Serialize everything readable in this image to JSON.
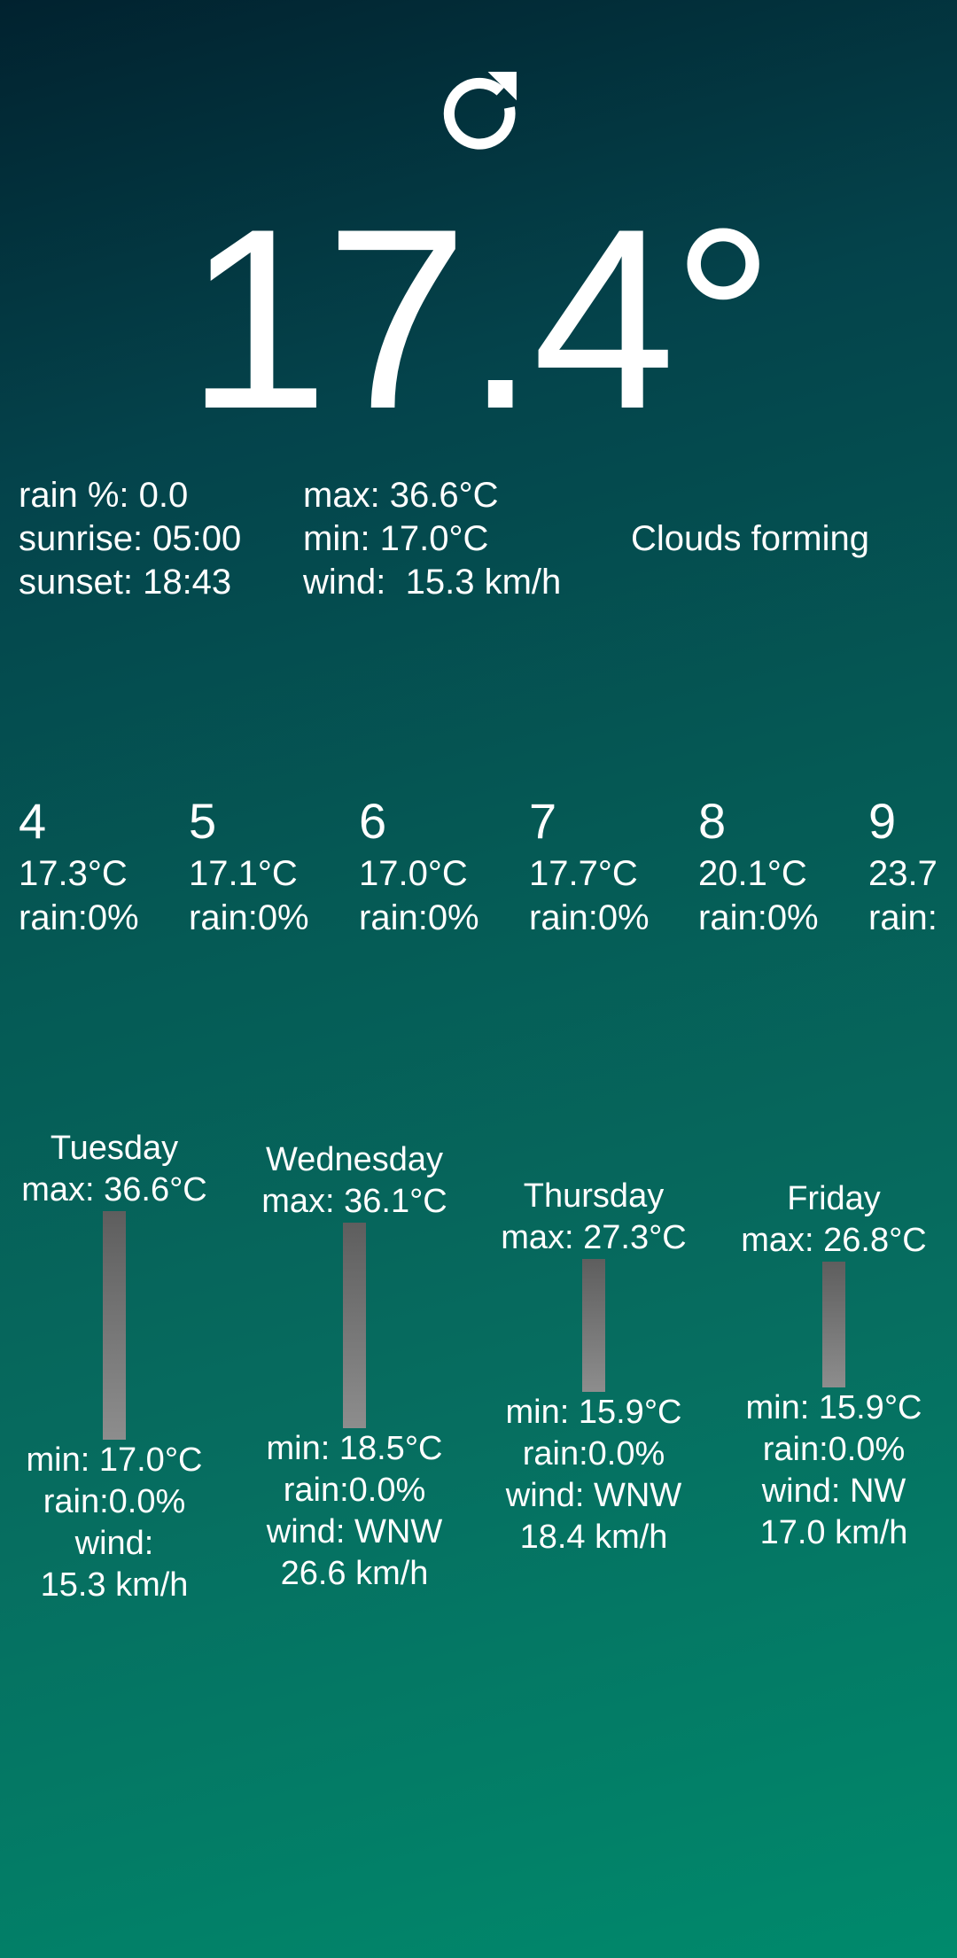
{
  "current": {
    "temperature": "17.4°",
    "rain": "rain %: 0.0",
    "sunrise": "sunrise: 05:00",
    "sunset": "sunset: 18:43",
    "max": "max: 36.6°C",
    "min": "min: 17.0°C",
    "wind": "wind:  15.3 km/h",
    "condition": "Clouds forming"
  },
  "hourly": [
    {
      "hour": "4",
      "temp": "17.3°C",
      "rain": "rain:0%"
    },
    {
      "hour": "5",
      "temp": "17.1°C",
      "rain": "rain:0%"
    },
    {
      "hour": "6",
      "temp": "17.0°C",
      "rain": "rain:0%"
    },
    {
      "hour": "7",
      "temp": "17.7°C",
      "rain": "rain:0%"
    },
    {
      "hour": "8",
      "temp": "20.1°C",
      "rain": "rain:0%"
    },
    {
      "hour": "9",
      "temp": "23.7",
      "rain": "rain:"
    }
  ],
  "daily": [
    {
      "day": "Tuesday",
      "max": "max: 36.6°C",
      "min": "min: 17.0°C",
      "rain": "rain:0.0%",
      "wind": "wind:",
      "wind_speed": "15.3 km/h"
    },
    {
      "day": "Wednesday",
      "max": "max: 36.1°C",
      "min": "min: 18.5°C",
      "rain": "rain:0.0%",
      "wind": "wind: WNW",
      "wind_speed": "26.6 km/h"
    },
    {
      "day": "Thursday",
      "max": "max: 27.3°C",
      "min": "min: 15.9°C",
      "rain": "rain:0.0%",
      "wind": "wind: WNW",
      "wind_speed": "18.4 km/h"
    },
    {
      "day": "Friday",
      "max": "max: 26.8°C",
      "min": "min: 15.9°C",
      "rain": "rain:0.0%",
      "wind": "wind: NW",
      "wind_speed": "17.0 km/h"
    }
  ],
  "icons": {
    "refresh": "refresh-icon"
  },
  "colors": {
    "background_top": "#01222f",
    "background_bottom": "#008a6c",
    "text": "#ffffff",
    "bar_top": "#5e5e5e",
    "bar_bottom": "#8d8d8d"
  }
}
